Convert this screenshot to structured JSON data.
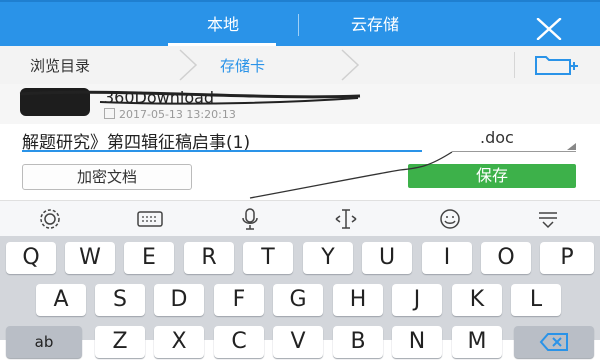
{
  "header": {
    "tabs": [
      {
        "label": "本地",
        "active": true
      },
      {
        "label": "云存储",
        "active": false
      }
    ],
    "close_icon": "close-icon",
    "accent_color": "#2a93e8"
  },
  "breadcrumb": {
    "items": [
      "浏览目录",
      "存储卡"
    ],
    "new_folder_icon": "new-folder-icon"
  },
  "file": {
    "name": "360Download",
    "date": "2017-05-13 13:20:13"
  },
  "form": {
    "filename": "解题研究》第四辑征稿启事(1)",
    "extension": ".doc",
    "encrypt_label": "加密文档",
    "save_label": "保存",
    "save_color": "#3db14a"
  },
  "keyboard_toolbar": {
    "icons": [
      "settings-icon",
      "keyboard-icon",
      "microphone-icon",
      "cursor-icon",
      "emoji-icon",
      "hide-keyboard-icon"
    ]
  },
  "keyboard": {
    "row1": [
      "Q",
      "W",
      "E",
      "R",
      "T",
      "Y",
      "U",
      "I",
      "O",
      "P"
    ],
    "row2": [
      "A",
      "S",
      "D",
      "F",
      "G",
      "H",
      "J",
      "K",
      "L"
    ],
    "row3_left": "ab",
    "row3": [
      "Z",
      "X",
      "C",
      "V",
      "B",
      "N",
      "M"
    ],
    "backspace_icon": "backspace-icon"
  }
}
